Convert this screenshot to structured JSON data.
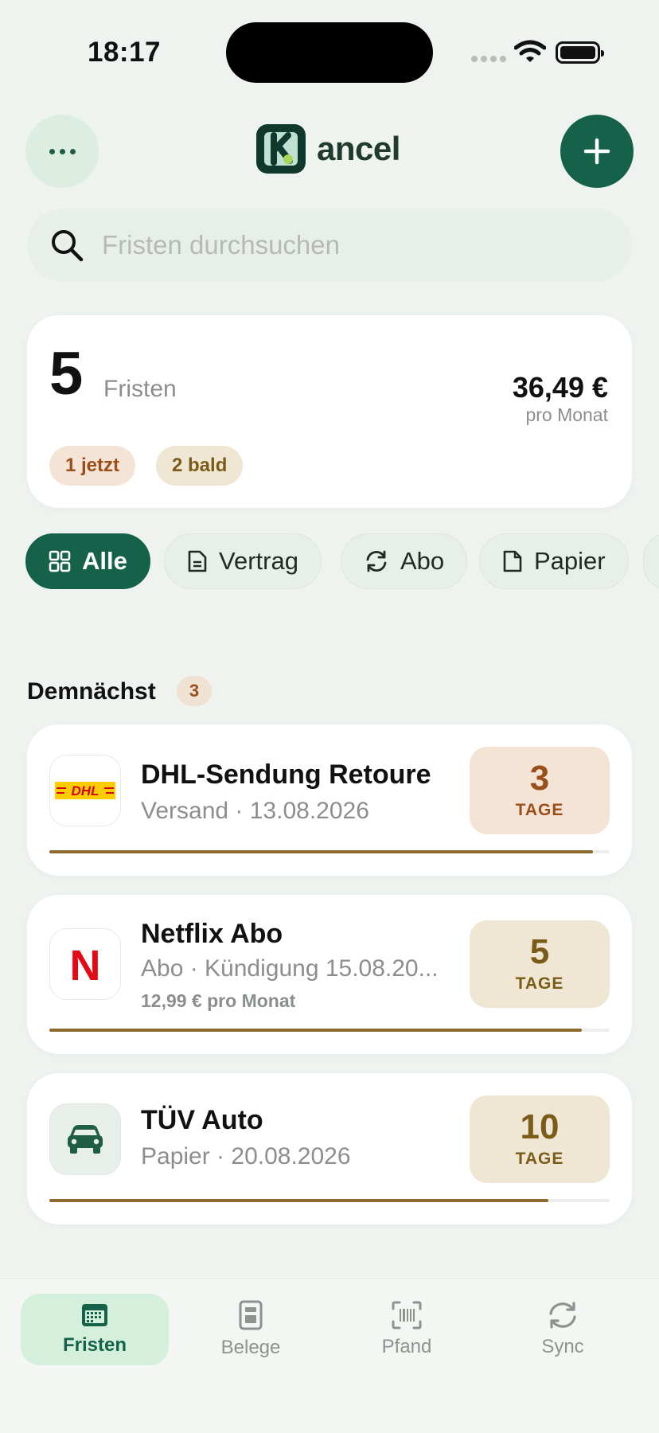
{
  "status_bar": {
    "time": "18:17"
  },
  "header": {
    "app_name": "ancel"
  },
  "search": {
    "placeholder": "Fristen durchsuchen"
  },
  "summary": {
    "count": "5",
    "count_label": "Fristen",
    "amount": "36,49 €",
    "amount_period": "pro Monat",
    "badges": [
      "1 jetzt",
      "2 bald"
    ]
  },
  "filters": [
    {
      "label": "Alle",
      "icon": "grid-icon",
      "active": true
    },
    {
      "label": "Vertrag",
      "icon": "document-icon",
      "active": false
    },
    {
      "label": "Abo",
      "icon": "refresh-icon",
      "active": false
    },
    {
      "label": "Papier",
      "icon": "paper-icon",
      "active": false
    }
  ],
  "section": {
    "title": "Demnächst",
    "count": "3"
  },
  "items": [
    {
      "title": "DHL-Sendung Retoure",
      "subtitle": "Versand · 13.08.2026",
      "extra": "",
      "days": "3",
      "days_unit": "TAGE",
      "icon": "dhl-logo",
      "logo_text": "DHL",
      "progress": 0.97,
      "accent": "#9a4e1a",
      "badge_bg": "#f4e4d6"
    },
    {
      "title": "Netflix Abo",
      "subtitle": "Abo · Kündigung 15.08.20...",
      "extra": "12,99 € pro Monat",
      "days": "5",
      "days_unit": "TAGE",
      "icon": "netflix-logo",
      "logo_text": "N",
      "progress": 0.95,
      "accent": "#7a5c18",
      "badge_bg": "#efe6d3"
    },
    {
      "title": "TÜV Auto",
      "subtitle": "Papier · 20.08.2026",
      "extra": "",
      "days": "10",
      "days_unit": "TAGE",
      "icon": "car-icon",
      "progress": 0.89,
      "accent": "#7a5c18",
      "badge_bg": "#efe6d3"
    }
  ],
  "tabbar": [
    {
      "label": "Fristen",
      "icon": "calendar-icon",
      "active": true
    },
    {
      "label": "Belege",
      "icon": "receipt-icon",
      "active": false
    },
    {
      "label": "Pfand",
      "icon": "barcode-scan-icon",
      "active": false
    },
    {
      "label": "Sync",
      "icon": "sync-icon",
      "active": false
    }
  ],
  "colors": {
    "brand": "#15614a",
    "background": "#eef3ef",
    "urgent": "#9a4e1a",
    "soon": "#7a5c18"
  }
}
